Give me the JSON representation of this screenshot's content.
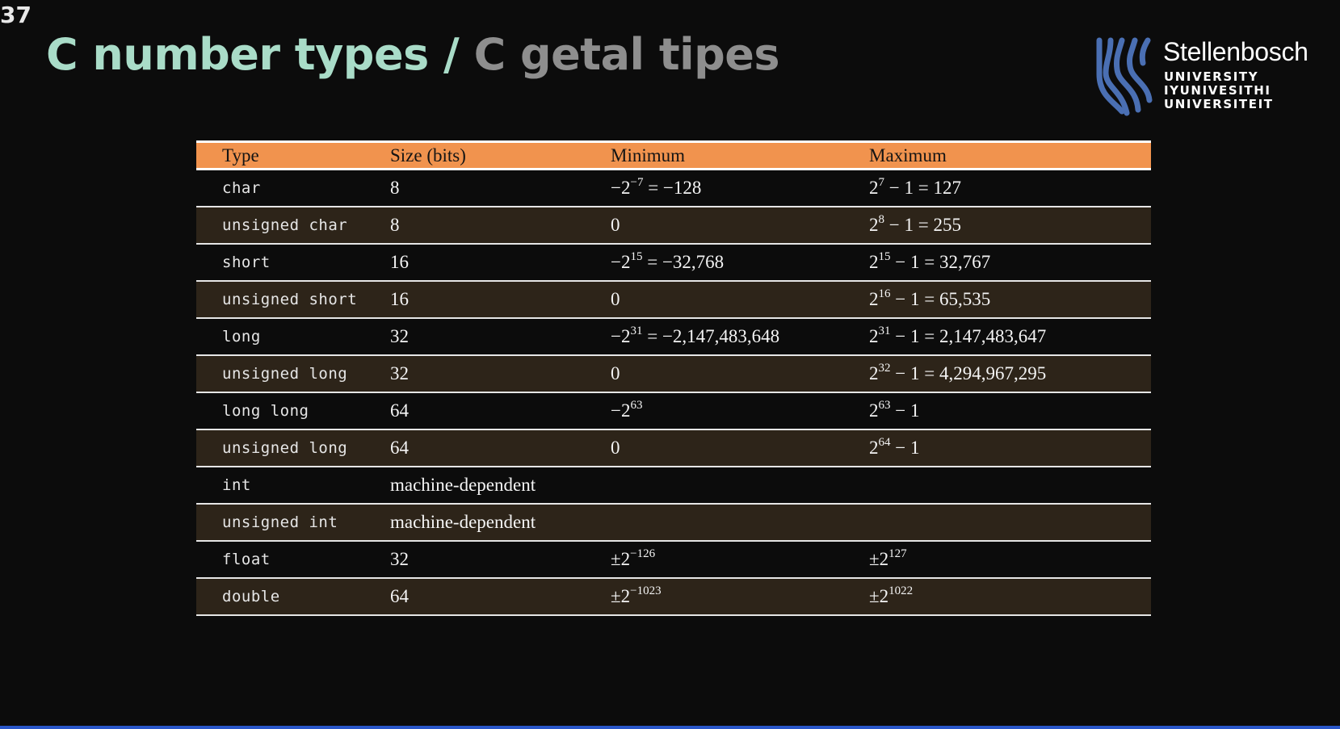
{
  "slide": {
    "number": "37"
  },
  "title": {
    "english": "C number types",
    "separator": " / ",
    "afrikaans": "C getal tipes"
  },
  "logo": {
    "name": "Stellenbosch",
    "line1": "UNIVERSITY",
    "line2": "IYUNIVESITHI",
    "line3": "UNIVERSITEIT",
    "color": "#4a6fb3"
  },
  "table": {
    "headers": [
      "Type",
      "Size (bits)",
      "Minimum",
      "Maximum"
    ],
    "rows": [
      {
        "type": "char",
        "size": "8",
        "min": [
          {
            "t": "−2"
          },
          {
            "s": "−7"
          },
          {
            "t": " = −128"
          }
        ],
        "max": [
          {
            "t": "2"
          },
          {
            "s": "7"
          },
          {
            "t": " − 1 = 127"
          }
        ]
      },
      {
        "type": "unsigned char",
        "size": "8",
        "min": [
          {
            "t": "0"
          }
        ],
        "max": [
          {
            "t": "2"
          },
          {
            "s": "8"
          },
          {
            "t": " − 1 = 255"
          }
        ]
      },
      {
        "type": "short",
        "size": "16",
        "min": [
          {
            "t": "−2"
          },
          {
            "s": "15"
          },
          {
            "t": " = −32,768"
          }
        ],
        "max": [
          {
            "t": "2"
          },
          {
            "s": "15"
          },
          {
            "t": " − 1 = 32,767"
          }
        ]
      },
      {
        "type": "unsigned short",
        "size": "16",
        "min": [
          {
            "t": "0"
          }
        ],
        "max": [
          {
            "t": "2"
          },
          {
            "s": "16"
          },
          {
            "t": " − 1 = 65,535"
          }
        ]
      },
      {
        "type": "long",
        "size": "32",
        "min": [
          {
            "t": "−2"
          },
          {
            "s": "31"
          },
          {
            "t": " = −2,147,483,648"
          }
        ],
        "max": [
          {
            "t": "2"
          },
          {
            "s": "31"
          },
          {
            "t": " − 1 = 2,147,483,647"
          }
        ]
      },
      {
        "type": "unsigned long",
        "size": "32",
        "min": [
          {
            "t": "0"
          }
        ],
        "max": [
          {
            "t": "2"
          },
          {
            "s": "32"
          },
          {
            "t": " − 1 = 4,294,967,295"
          }
        ]
      },
      {
        "type": "long long",
        "size": "64",
        "min": [
          {
            "t": "−2"
          },
          {
            "s": "63"
          }
        ],
        "max": [
          {
            "t": "2"
          },
          {
            "s": "63"
          },
          {
            "t": " − 1"
          }
        ]
      },
      {
        "type": "unsigned long",
        "size": "64",
        "min": [
          {
            "t": "0"
          }
        ],
        "max": [
          {
            "t": "2"
          },
          {
            "s": "64"
          },
          {
            "t": " − 1"
          }
        ]
      },
      {
        "type": "int",
        "size": "machine-dependent",
        "min": [],
        "max": []
      },
      {
        "type": "unsigned int",
        "size": "machine-dependent",
        "min": [],
        "max": []
      },
      {
        "type": "float",
        "size": "32",
        "min": [
          {
            "t": "±2"
          },
          {
            "s": "−126"
          }
        ],
        "max": [
          {
            "t": "±2"
          },
          {
            "s": "127"
          }
        ]
      },
      {
        "type": "double",
        "size": "64",
        "min": [
          {
            "t": "±2"
          },
          {
            "s": "−1023"
          }
        ],
        "max": [
          {
            "t": "±2"
          },
          {
            "s": "1022"
          }
        ]
      }
    ]
  },
  "colors": {
    "header_bg": "#f1934e",
    "alt_row_bg": "#2d2419",
    "title_en": "#a9dcc8",
    "title_af": "#8e8e8e",
    "bottom_bar": "#2a57c9"
  }
}
